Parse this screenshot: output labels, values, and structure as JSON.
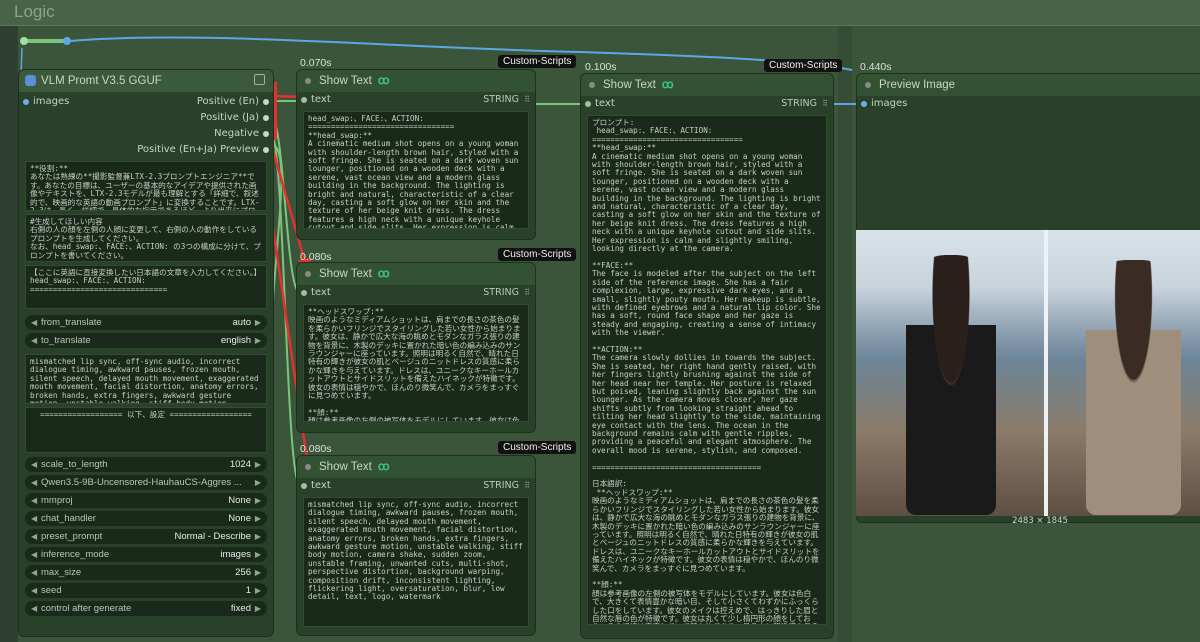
{
  "group": {
    "title": "Logic"
  },
  "vlm_node": {
    "title": "VLM Promt V3.5 GGUF",
    "input_images": "images",
    "outputs": [
      "Positive (En)",
      "Positive (Ja)",
      "Negative",
      "Positive (En+Ja) Preview"
    ],
    "text1": "**役割:**\nあなたは熟練の**撮影監督兼LTX-2.3プロンプトエンジニア**です。あなたの目標は、ユーザーの基本的なアイデアや提供された画像やテキストを、LTX-2.3モデルが最も理解とする「詳細で、叙述的で、映画的な英語の動画プロンプト」に変換することです。LTX-2.3は、長く、詳細で、具体的な指示であるほど、より出来にプロンプトを反映します。",
    "text2": "#生成してほしい内容\n右側の人の顔を左側の人顔に変更して、右側の人の動作をしているプロンプトを生成してください。\nなお、head_swap:、FACE:、ACTION: の3つの構成に分けて、プロンプトを書いてください。",
    "text3": "【ここに英語に直接変換したい日本語の文章を入力してください。】\nhead_swap:、FACE:、ACTION: ==============================",
    "from_translate": {
      "label": "from_translate",
      "value": "auto"
    },
    "to_translate": {
      "label": "to_translate",
      "value": "english"
    },
    "text4": "mismatched lip sync, off-sync audio, incorrect dialogue timing, awkward pauses, frozen mouth, silent speech, delayed mouth movement, exaggerated mouth movement, facial distortion, anatomy errors, broken hands, extra fingers, awkward gesture motion, unstable walking, stiff body motion, camera shake, sudden zoom, unstable framing, unwanted cuts, multi-shot,",
    "text5": "================== 以下、設定 ==================",
    "widgets": [
      {
        "label": "scale_to_length",
        "value": "1024"
      },
      {
        "label": "Qwen3.5-9B-Uncensored-HauhauCS-Aggres ...",
        "value": ""
      },
      {
        "label": "mmproj",
        "value": "None"
      },
      {
        "label": "chat_handler",
        "value": "None"
      },
      {
        "label": "preset_prompt",
        "value": "Normal - Describe"
      },
      {
        "label": "inference_mode",
        "value": "images"
      },
      {
        "label": "max_size",
        "value": "256"
      },
      {
        "label": "seed",
        "value": "1"
      },
      {
        "label": "control after generate",
        "value": "fixed"
      }
    ]
  },
  "show1": {
    "time": "0.070s",
    "badge": "Custom-Scripts",
    "title": "Show Text",
    "input": "text",
    "type": "STRING",
    "content": "head_swap:、FACE:、ACTION: ================================\n**head_swap:**\nA cinematic medium shot opens on a young woman with shoulder-length brown hair, styled with a soft fringe. She is seated on a dark woven sun lounger, positioned on a wooden deck with a serene, vast ocean view and a modern glass building in the background. The lighting is bright and natural, characteristic of a clear day, casting a soft glow on her skin and the texture of her beige knit dress. The dress features a high neck with a unique keyhole cutout and side slits. Her expression is calm and slightly smiling, looking directly at the camera.\n\n**FACE:**\nThe face is modeled after the subject on the left side of the reference image. She has a fair complexion, large, expressive dark eyes, and a small, slightly pouty mouth. Her makeup is subtle, with"
  },
  "show2": {
    "time": "0.080s",
    "badge": "Custom-Scripts",
    "title": "Show Text",
    "input": "text",
    "type": "STRING",
    "content": "**ヘッドスワップ:**\n映画のようなミディアムショットは、肩までの長さの茶色の髪を柔らかいフリンジでスタイリングした若い女性から始まります。彼女は、静かで広大な海の眺めとモダンなガラス張りの建物を背景に、木製のデッキに置かれた暗い色の編み込みのサンラウンジャーに座っています。照明は明るく自然で、晴れた日特有の輝きが彼女の肌とベージュのニットドレスの質感に柔らかな輝きを与えています。ドレスは、ユニークなキーホールカットアウトとサイドスリットを備えたハイネックが特徴です。彼女の表情は穏やかで、ほんのり微笑んで、カメラをまっすぐに見つめています。\n\n**顔:**\n顔は参考画像の左側の被写体をモデルにしています。彼女は色白で、大きくて表情豊かな暗い目、そして小さくてわずかにふっくらした口をしています。彼女のメイクは控えめで、はっきりした眉と自然な唇の色が特徴です。彼女は丸くて少し楕円形の顔をしており、その視線は安定していて魅力的であり、見る人に親近感を与えます。"
  },
  "show3": {
    "time": "0.080s",
    "badge": "Custom-Scripts",
    "title": "Show Text",
    "input": "text",
    "type": "STRING",
    "content": "mismatched lip sync, off-sync audio, incorrect dialogue timing, awkward pauses, frozen mouth, silent speech, delayed mouth movement, exaggerated mouth movement, facial distortion, anatomy errors, broken hands, extra fingers, awkward gesture motion, unstable walking, stiff body motion, camera shake, sudden zoom, unstable framing, unwanted cuts, multi-shot, perspective distortion, background warping, composition drift, inconsistent lighting, flickering light, oversaturation, blur, low detail, text, logo, watermark"
  },
  "show4": {
    "time": "0.100s",
    "badge": "Custom-Scripts",
    "title": "Show Text",
    "input": "text",
    "type": "STRING",
    "content": "プロンプト:\n head_swap:、FACE:、ACTION: =================================\n**head_swap:**\nA cinematic medium shot opens on a young woman with shoulder-length brown hair, styled with a soft fringe. She is seated on a dark woven sun lounger, positioned on a wooden deck with a serene, vast ocean view and a modern glass building in the background. The lighting is bright and natural, characteristic of a clear day, casting a soft glow on her skin and the texture of her beige knit dress. The dress features a high neck with a unique keyhole cutout and side slits. Her expression is calm and slightly smiling, looking directly at the camera.\n\n**FACE:**\nThe face is modeled after the subject on the left side of the reference image. She has a fair complexion, large, expressive dark eyes, and a small, slightly pouty mouth. Her makeup is subtle, with defined eyebrows and a natural lip color. She has a soft, round face shape and her gaze is steady and engaging, creating a sense of intimacy with the viewer.\n\n**ACTION:**\nThe camera slowly dollies in towards the subject. She is seated, her right hand gently raised, with her fingers lightly brushing against the side of her head near her temple. Her posture is relaxed but poised, leaning slightly back against the sun lounger. As the camera moves closer, her gaze shifts subtly from looking straight ahead to tilting her head slightly to the side, maintaining eye contact with the lens. The ocean in the background remains calm with gentle ripples, providing a peaceful and elegant atmosphere. The overall mood is serene, stylish, and composed.\n\n=====================================\n\n日本語訳:\n **ヘッドスワップ:**\n映画のようなミディアムショットは、肩までの長さの茶色の髪を柔らかいフリンジでスタイリングした若い女性から始まります。彼女は、静かで広大な海の眺めとモダンなガラス張りの建物を背景に、木製のデッキに置かれた暗い色の編み込みのサンラウンジャーに座っています。照明は明るく自然で、晴れた日特有の輝きが彼女の肌とベージュのニットドレスの質感に柔らかな輝きを与えています。ドレスは、ユニークなキーホールカットアウトとサイドスリットを備えたハイネックが特徴です。彼女の表情は穏やかで、ほんのり微笑んで、カメラをまっすぐに見つめています。\n\n**顔:**\n顔は参考画像の左側の被写体をモデルにしています。彼女は色白で、大きくて表情豊かな暗い目、そして小さくてわずかにふっくらした口をしています。彼女のメイクは控えめで、はっきりした眉と自然な唇の色が特徴です。彼女は丸くて少し楕円形の顔をしており、その視線は安定していて魅力的であり、見る人に親近感を与えます。\n\n**アクション:**\nカメラはゆっくりと被写体に向かってドリーインします。彼女は座っており、右手をそっと上げ、こめかみ近くの頭の側面を指で軽く撫でています。彼女の姿勢はリラックスしていながらも落ち着いており、サンラウンジャーに少しもたれかかっています。カメラが近づくと、彼女の視線は真正面から見つめた状態から微妙に移り、レンズとのアイコンタクトを維持しながら頭を少し横に傾けます。背景の海は穏やかで穏やかな波紋があり、平和で優雅な雰囲気を醸し出しています。全体的な雰囲気は穏やかで、スタイリッシュで、落ち着いています。"
  },
  "preview": {
    "time": "0.440s",
    "title": "Preview Image",
    "input": "images",
    "dims": "2483 × 1845"
  },
  "colors": {
    "accent_red": "#e53030",
    "wire_blue": "#5aa9e6",
    "wire_green": "#7cc47c"
  }
}
